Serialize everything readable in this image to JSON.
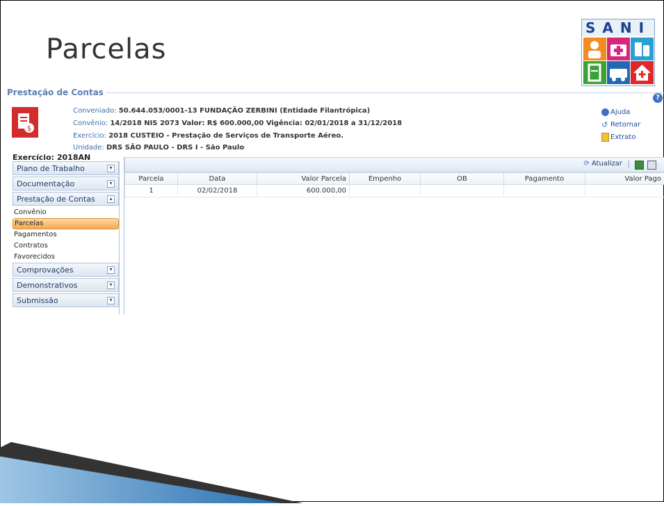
{
  "slide": {
    "title": "Parcelas",
    "logo_text": "SANI"
  },
  "section": {
    "legend": "Prestação de Contas"
  },
  "header_info": {
    "conveniado_label": "Conveniado:",
    "conveniado_value": "50.644.053/0001-13  FUNDAÇÃO ZERBINI  (Entidade Filantrópica)",
    "convenio_label": "Convênio:",
    "convenio_value": "14/2018 NIS 2073 Valor: R$ 600.000,00 Vigência: 02/01/2018 a 31/12/2018",
    "exercicio_label": "Exercício:",
    "exercicio_value": "2018  CUSTEIO - Prestação de Serviços de Transporte Aéreo.",
    "unidade_label": "Unidade:",
    "unidade_value": "DRS SÃO PAULO - DRS I - São Paulo"
  },
  "actions": {
    "ajuda": "Ajuda",
    "retornar": "Retornar",
    "extrato": "Extrato"
  },
  "sidebar": {
    "exercise": "Exercício: 2018AN",
    "plano": "Plano de Trabalho",
    "documentacao": "Documentação",
    "prestacao": "Prestação de Contas",
    "sub": {
      "convenio": "Convênio",
      "parcelas": "Parcelas",
      "pagamentos": "Pagamentos",
      "contratos": "Contratos",
      "favorecidos": "Favorecidos"
    },
    "comprovacoes": "Comprovações",
    "demonstrativos": "Demonstrativos",
    "submissao": "Submissão"
  },
  "toolbar": {
    "atualizar": "Atualizar"
  },
  "grid": {
    "columns": {
      "parcela": "Parcela",
      "data": "Data",
      "valor": "Valor Parcela",
      "empenho": "Empenho",
      "ob": "OB",
      "pagamento": "Pagamento",
      "pago": "Valor Pago"
    },
    "row": {
      "parcela": "1",
      "data": "02/02/2018",
      "valor": "600.000,00",
      "empenho": "",
      "ob": "",
      "pagamento": "",
      "pago": ""
    }
  },
  "colors": {
    "accent_blue": "#5b7fb1",
    "active_orange": "#f5a950",
    "icon_red": "#d22c2c"
  }
}
